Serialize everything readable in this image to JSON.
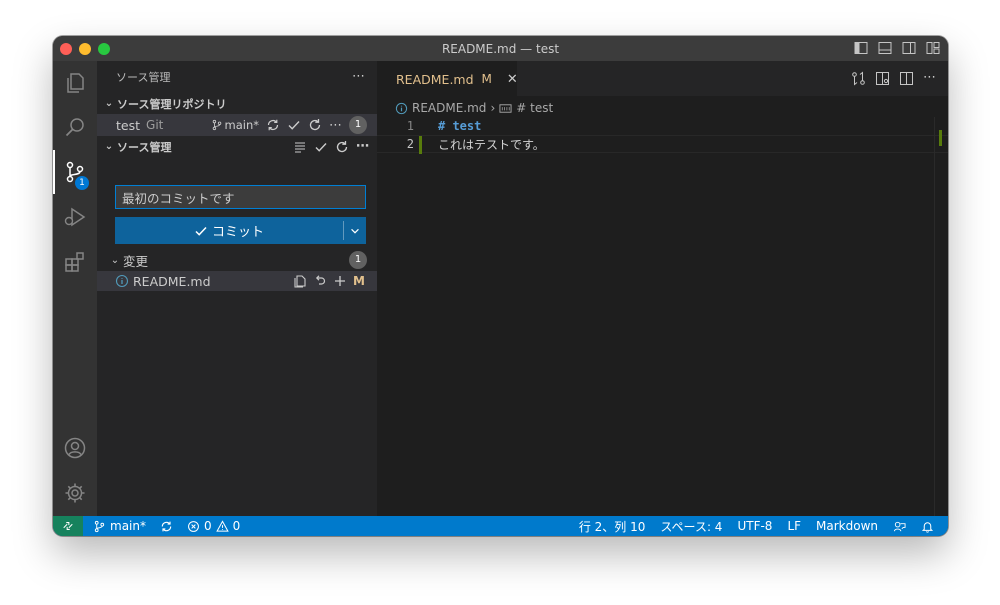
{
  "window": {
    "title": "README.md — test"
  },
  "activity": {
    "scm_badge": "1"
  },
  "sidebar": {
    "header": "ソース管理",
    "repos_section": "ソース管理リポジトリ",
    "repo": {
      "name": "test",
      "provider": "Git",
      "branch": "main*",
      "count": "1"
    },
    "scm_section": "ソース管理",
    "commit_input": {
      "value": "最初のコミットです"
    },
    "commit_button": "コミット",
    "changes": {
      "label": "変更",
      "count": "1"
    },
    "file": {
      "name": "README.md",
      "status": "M"
    }
  },
  "editor": {
    "tab": {
      "label": "README.md",
      "status": "M"
    },
    "breadcrumb": {
      "file": "README.md",
      "symbol": "# test"
    },
    "lines": [
      {
        "number": "1",
        "text": "# test"
      },
      {
        "number": "2",
        "text": "これはテストです。"
      }
    ]
  },
  "status": {
    "branch": "main*",
    "errors": "0",
    "warnings": "0",
    "position": "行 2、列 10",
    "spaces": "スペース: 4",
    "encoding": "UTF-8",
    "eol": "LF",
    "language": "Markdown"
  },
  "colors": {
    "accent": "#007acc",
    "button": "#0e639c",
    "modified": "#e2c08d",
    "remote": "#16825d"
  }
}
